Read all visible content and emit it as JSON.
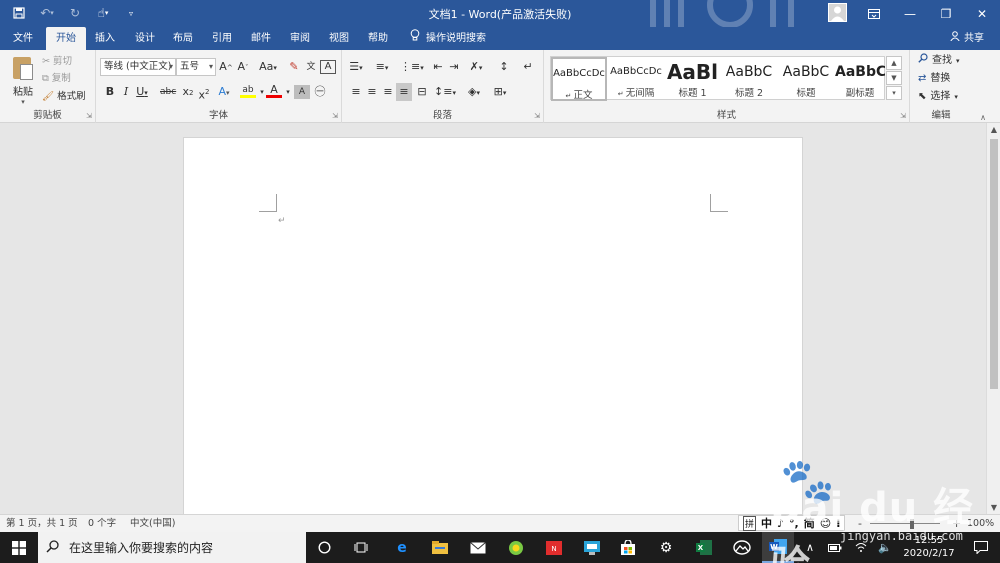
{
  "window": {
    "title": "文档1 - Word(产品激活失败)",
    "controls": [
      "restore-ribbon",
      "minimize",
      "maximize",
      "close"
    ]
  },
  "tabs": [
    {
      "label": "文件",
      "active": false
    },
    {
      "label": "开始",
      "active": true
    },
    {
      "label": "插入",
      "active": false
    },
    {
      "label": "设计",
      "active": false
    },
    {
      "label": "布局",
      "active": false
    },
    {
      "label": "引用",
      "active": false
    },
    {
      "label": "邮件",
      "active": false
    },
    {
      "label": "审阅",
      "active": false
    },
    {
      "label": "视图",
      "active": false
    },
    {
      "label": "帮助",
      "active": false
    }
  ],
  "tell_me": "操作说明搜索",
  "share": "共享",
  "clipboard": {
    "paste": "粘贴",
    "cut": "剪切",
    "copy": "复制",
    "format_painter": "格式刷",
    "label": "剪贴板"
  },
  "font": {
    "name": "等线 (中文正文)",
    "size": "五号",
    "label": "字体",
    "case_button": "Aa"
  },
  "paragraph": {
    "label": "段落"
  },
  "styles": {
    "label": "样式",
    "items": [
      {
        "sample": "AaBbCcDc",
        "name": "正文"
      },
      {
        "sample": "AaBbCcDc",
        "name": "无间隔"
      },
      {
        "sample": "AaBl",
        "name": "标题 1"
      },
      {
        "sample": "AaBbC",
        "name": "标题 2"
      },
      {
        "sample": "AaBbC",
        "name": "标题"
      },
      {
        "sample": "AaBbC",
        "name": "副标题"
      }
    ]
  },
  "editing": {
    "label": "编辑",
    "find": "查找",
    "replace": "替换",
    "select": "选择"
  },
  "status": {
    "page": "第 1 页，共 1 页",
    "words": "0 个字",
    "language": "中文(中国)",
    "zoom": "100%",
    "zoom_minus": "-",
    "zoom_plus": "+"
  },
  "ime": [
    "拼",
    "中",
    "♪",
    "°,",
    "简",
    "😊",
    "⁝"
  ],
  "taskbar": {
    "search_placeholder": "在这里输入你要搜索的内容",
    "ime_indicator": "中",
    "time": "12:55",
    "date": "2020/2/17"
  },
  "watermark": {
    "brand": "Bai du 经验",
    "url": "jingyan.baidu.com"
  },
  "colors": {
    "word_blue": "#2b579a",
    "ribbon_bg": "#f3f3f3",
    "taskbar_bg": "#1c1c1c"
  }
}
